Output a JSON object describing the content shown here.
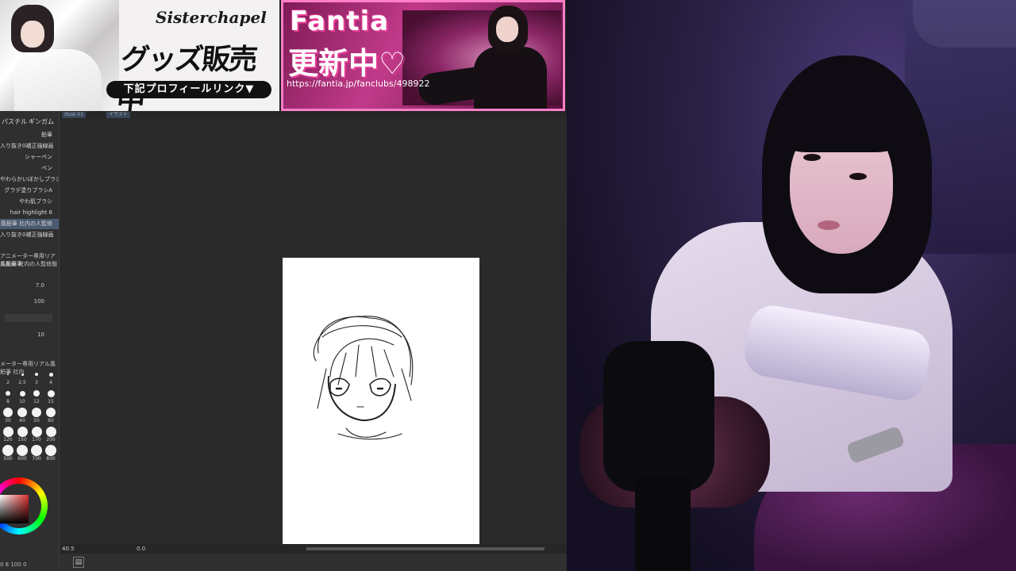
{
  "banner_left": {
    "logo": "Sisterchapel",
    "headline": "グッズ販売中",
    "link_pill": "下記プロフィールリンク▼"
  },
  "banner_right": {
    "title": "Fantia",
    "subtitle": "更新中♡",
    "url": "https://fantia.jp/fanclubs/498922"
  },
  "paint_app": {
    "panel_tabs": [
      "パステル",
      "ギンガム"
    ],
    "brushes": [
      {
        "label": "鉛筆",
        "selected": false
      },
      {
        "label": "入り抜き0補正強線画",
        "selected": false
      },
      {
        "label": "シャーペン",
        "selected": false
      },
      {
        "label": "ペン",
        "selected": false
      },
      {
        "label": "やわらかいぼかしブラシ",
        "selected": false
      },
      {
        "label": "グラデ塗りブラシA",
        "selected": false
      },
      {
        "label": "やわ肌ブラシ",
        "selected": false
      },
      {
        "label": "hair highlight 6",
        "selected": false
      },
      {
        "label": "風鉛筆 社内の人監修",
        "selected": true
      },
      {
        "label": "入り抜き0補正強線画",
        "selected": false
      }
    ],
    "property_title": "アニメーター専用リアル風鉛筆",
    "property_brush": "風鉛筆 社内の人監修版",
    "brush_size": "7.0",
    "opacity": "100",
    "density": "10",
    "size_palette_title": "メーター専用リアル風鉛筆 社内",
    "size_values": [
      "2",
      "2.5",
      "3",
      "4",
      "8",
      "10",
      "12",
      "15",
      "30",
      "40",
      "50",
      "60",
      "120",
      "150",
      "170",
      "200",
      "500",
      "600",
      "700",
      "800"
    ],
    "doc_tabs": [
      "illust-01",
      "イラスト"
    ],
    "status_zoom": "40.5",
    "status_angle": "0.0",
    "bottom_left_readout": "0  8  100  0",
    "colors": {
      "main": "#e23030",
      "panel": "#2f2f2f",
      "canvas_bg": "#2a2a2a"
    }
  },
  "webcam": {
    "accent": "#4a3a78"
  }
}
